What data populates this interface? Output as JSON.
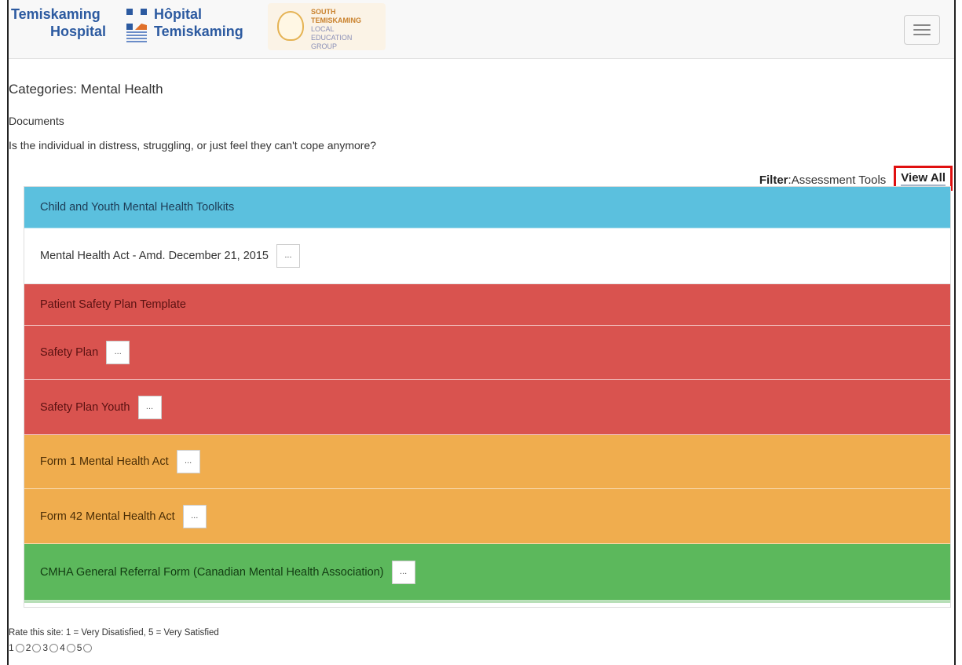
{
  "header": {
    "logo_en_line1": "Temiskaming",
    "logo_en_line2": "Hospital",
    "logo_fr_line1": "Hôpital",
    "logo_fr_line2": "Temiskaming",
    "leg_top": "SOUTH TEMISKAMING",
    "leg_line1": "LOCAL",
    "leg_line2": "EDUCATION",
    "leg_line3": "GROUP",
    "brand_color": "#2c5aa0"
  },
  "page": {
    "categories": "Categories: Mental Health",
    "documents": "Documents",
    "question": "Is the individual in distress, struggling, or just feel they can't cope anymore?"
  },
  "filter": {
    "label": "Filter",
    "colon": ":",
    "option": "Assessment Tools",
    "view_all": "View All",
    "highlight_color": "#e01010"
  },
  "items": [
    {
      "label": "Child and Youth Mental Health Toolkits",
      "color": "#5bc0de",
      "has_more": false
    },
    {
      "label": "Mental Health Act - Amd. December 21, 2015",
      "color": "#ffffff",
      "has_more": true
    },
    {
      "label": "Patient Safety Plan Template",
      "color": "#d9534f",
      "has_more": false
    },
    {
      "label": "Safety Plan",
      "color": "#d9534f",
      "has_more": true
    },
    {
      "label": "Safety Plan Youth",
      "color": "#d9534f",
      "has_more": true
    },
    {
      "label": "Form 1 Mental Health Act",
      "color": "#f0ad4e",
      "has_more": true
    },
    {
      "label": "Form 42 Mental Health Act",
      "color": "#f0ad4e",
      "has_more": true
    },
    {
      "label": "CMHA General Referral Form (Canadian Mental Health Association)",
      "color": "#5cb85c",
      "has_more": true
    }
  ],
  "more_label": "...",
  "rating": {
    "prompt": "Rate this site: 1 = Very Disatisfied, 5 = Very Satisfied",
    "options": [
      "1",
      "2",
      "3",
      "4",
      "5"
    ]
  }
}
